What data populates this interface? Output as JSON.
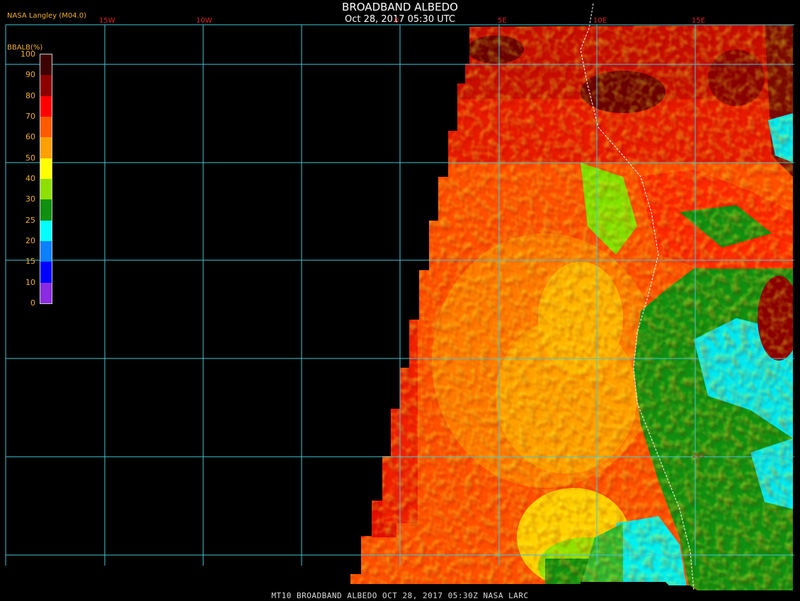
{
  "header": {
    "title": "BROADBAND ALBEDO",
    "subtitle": "Oct 28, 2017 05:30 UTC",
    "credit": "NASA Langley (M04.0)"
  },
  "legend": {
    "title": "BBALB(%)",
    "ticks": [
      "100",
      "90",
      "80",
      "70",
      "60",
      "50",
      "40",
      "30",
      "25",
      "20",
      "15",
      "10",
      "0"
    ],
    "colors": [
      "#3c0000",
      "#8e0000",
      "#ff0000",
      "#ff5a00",
      "#ffa000",
      "#ffff00",
      "#8ee000",
      "#109010",
      "#00ffff",
      "#0a80ff",
      "#0000ff",
      "#8a2be2"
    ]
  },
  "grid": {
    "lon_labels": [
      "15W",
      "10W",
      "0",
      "5E",
      "10E",
      "15E"
    ],
    "lat_labels": [
      "",
      "20S"
    ]
  },
  "footer": {
    "text": "MT10  BROADBAND ALBEDO   OCT 28, 2017 05:30Z   NASA LARC"
  },
  "colors": {
    "grid": "#40c8d8",
    "coast": "#ffffff",
    "background": "#000000"
  }
}
